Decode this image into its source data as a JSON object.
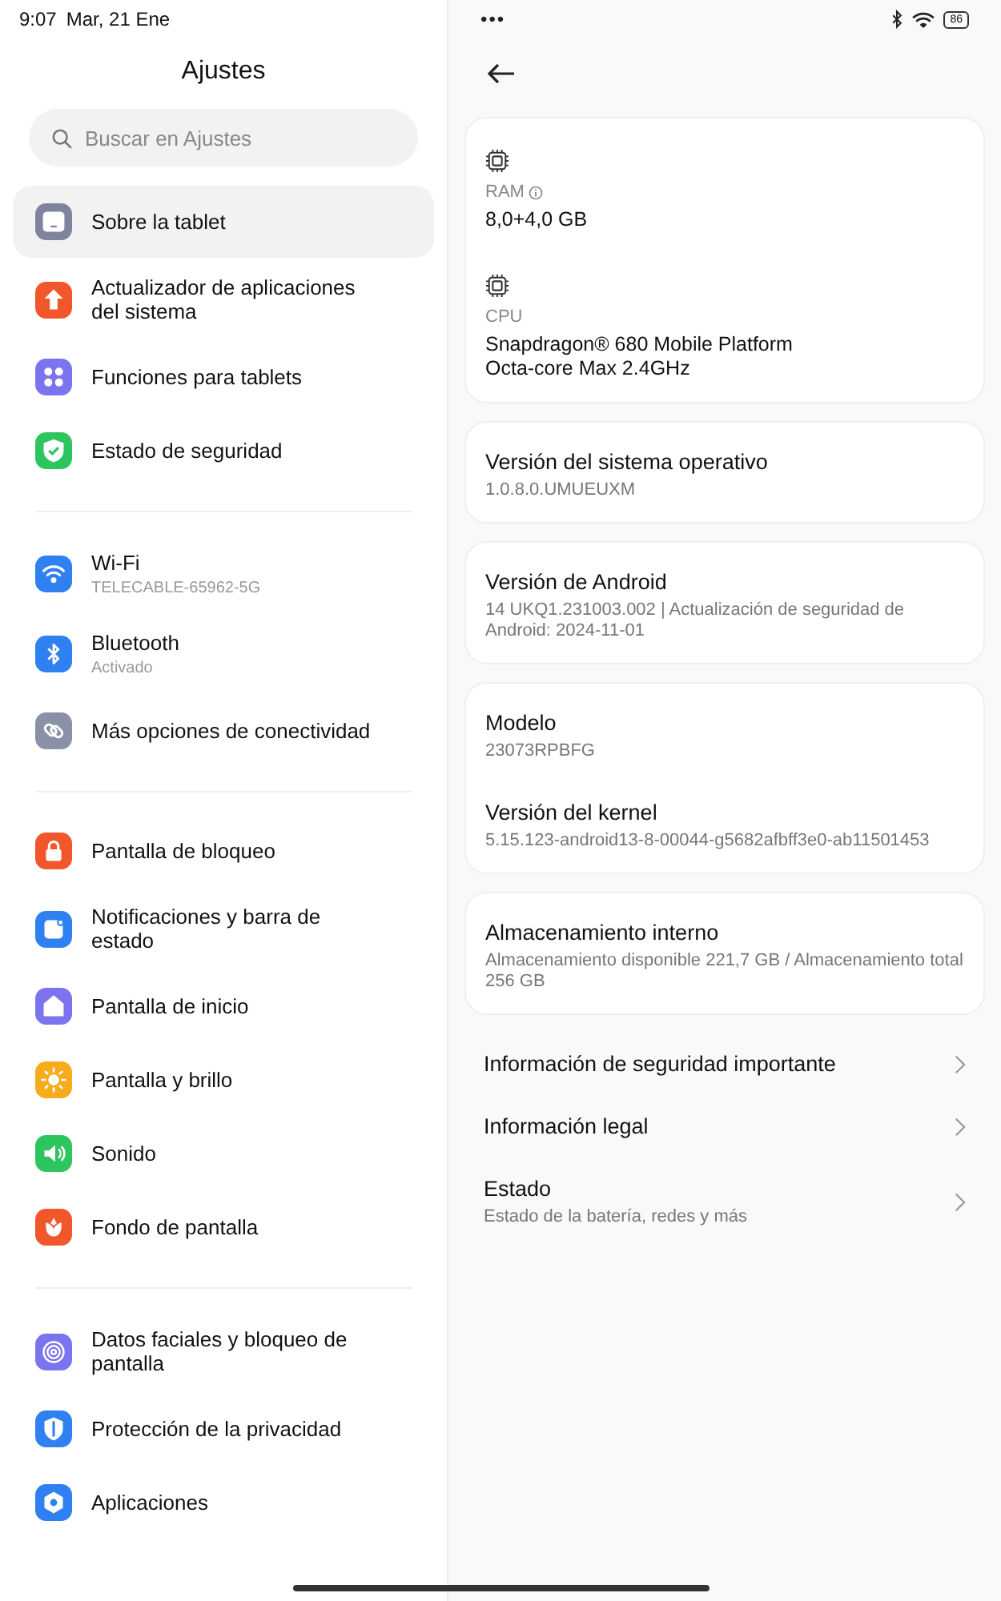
{
  "status_bar": {
    "time": "9:07",
    "date": "Mar, 21 Ene",
    "menu_dots": "•••",
    "battery": "86"
  },
  "sidebar": {
    "title": "Ajustes",
    "search": {
      "placeholder": "Buscar en Ajustes"
    },
    "groups": [
      {
        "items": [
          {
            "label": "Sobre la tablet",
            "color": "#7e849c",
            "selected": true
          },
          {
            "label": "Actualizador de aplicaciones del sistema",
            "color": "#f2572b",
            "selected": false
          },
          {
            "label": "Funciones para tablets",
            "color": "#7b74ee",
            "selected": false
          },
          {
            "label": "Estado de seguridad",
            "color": "#2dc55e",
            "selected": false
          }
        ]
      },
      {
        "items": [
          {
            "label": "Wi-Fi",
            "sublabel": "TELECABLE-65962-5G",
            "color": "#2f80f0",
            "selected": false
          },
          {
            "label": "Bluetooth",
            "sublabel": "Activado",
            "color": "#2f80f0",
            "selected": false
          },
          {
            "label": "Más opciones de conectividad",
            "color": "#8a90a6",
            "selected": false
          }
        ]
      },
      {
        "items": [
          {
            "label": "Pantalla de bloqueo",
            "color": "#f2572b",
            "selected": false
          },
          {
            "label": "Notificaciones y barra de estado",
            "color": "#2f80f0",
            "selected": false
          },
          {
            "label": "Pantalla de inicio",
            "color": "#7b74ee",
            "selected": false
          },
          {
            "label": "Pantalla y brillo",
            "color": "#f7ac1b",
            "selected": false
          },
          {
            "label": "Sonido",
            "color": "#2dc55e",
            "selected": false
          },
          {
            "label": "Fondo de pantalla",
            "color": "#f2572b",
            "selected": false
          }
        ]
      },
      {
        "items": [
          {
            "label": "Datos faciales y bloqueo de pantalla",
            "color": "#7b74ee",
            "selected": false
          },
          {
            "label": "Protección de la privacidad",
            "color": "#2f80f0",
            "selected": false
          },
          {
            "label": "Aplicaciones",
            "color": "#2f80f0",
            "selected": false
          }
        ]
      }
    ]
  },
  "detail": {
    "cards": [
      {
        "fields": [
          {
            "kind": "spec",
            "label": "RAM",
            "info": true,
            "value": "8,0+4,0 GB"
          },
          {
            "kind": "spec",
            "label": "CPU",
            "value": "Snapdragon® 680 Mobile Platform\nOcta-core Max 2.4GHz"
          }
        ]
      },
      {
        "fields": [
          {
            "kind": "plain",
            "label": "Versión del sistema operativo",
            "value": "1.0.8.0.UMUEUXM"
          }
        ]
      },
      {
        "fields": [
          {
            "kind": "plain",
            "label": "Versión de Android",
            "value": "14 UKQ1.231003.002 | Actualización de seguridad de Android: 2024-11-01"
          }
        ]
      },
      {
        "fields": [
          {
            "kind": "plain",
            "label": "Modelo",
            "value": "23073RPBFG"
          },
          {
            "kind": "plain",
            "label": "Versión del kernel",
            "value": "5.15.123-android13-8-00044-g5682afbff3e0-ab11501453"
          }
        ]
      },
      {
        "fields": [
          {
            "kind": "plain",
            "label": "Almacenamiento interno",
            "value": "Almacenamiento disponible  221,7 GB / Almacenamiento total  256 GB"
          }
        ]
      }
    ],
    "links": [
      {
        "title": "Información de seguridad importante"
      },
      {
        "title": "Información legal"
      },
      {
        "title": "Estado",
        "subtitle": "Estado de la batería, redes y más"
      }
    ]
  }
}
